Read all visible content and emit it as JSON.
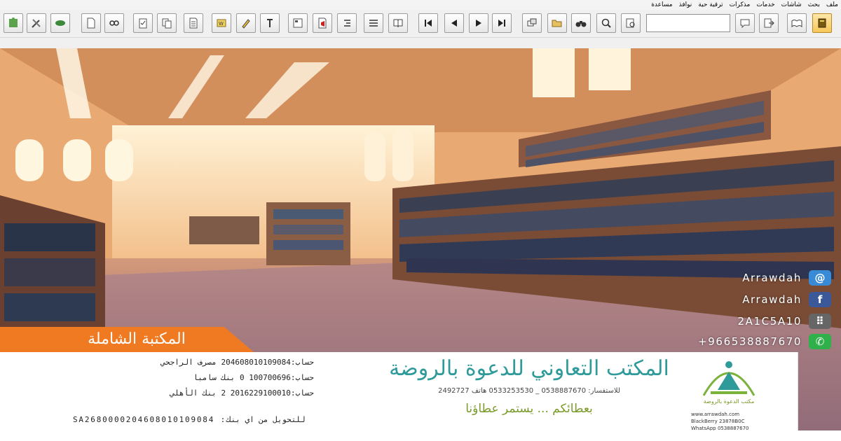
{
  "menu": [
    "ملف",
    "بحث",
    "شاشات",
    "خدمات",
    "مذكرات",
    "ترقية حية",
    "نوافذ",
    "مساعدة"
  ],
  "toolbar": {
    "buttons": [
      {
        "icon": "puzzle-icon"
      },
      {
        "icon": "tools-icon"
      },
      {
        "icon": "leaf-icon"
      },
      {
        "icon": "new-document-icon"
      },
      {
        "icon": "link-icon"
      },
      {
        "icon": "clipboard-icon"
      },
      {
        "icon": "copy-icon"
      },
      {
        "icon": "document-list-icon"
      },
      {
        "icon": "word-icon"
      },
      {
        "icon": "pencil-icon"
      },
      {
        "icon": "text-format-icon"
      },
      {
        "icon": "form-icon"
      },
      {
        "icon": "pdf-icon"
      },
      {
        "icon": "indent-icon"
      },
      {
        "icon": "justify-icon"
      },
      {
        "icon": "book-icon"
      },
      {
        "icon": "first-page-icon"
      },
      {
        "icon": "previous-page-icon"
      },
      {
        "icon": "next-page-icon"
      },
      {
        "icon": "last-page-icon"
      },
      {
        "icon": "windows-icon"
      },
      {
        "icon": "open-folder-icon"
      },
      {
        "icon": "binoculars-icon"
      },
      {
        "icon": "zoom-search-icon"
      },
      {
        "icon": "search-document-icon"
      },
      {
        "icon": "comment-icon"
      },
      {
        "icon": "export-icon"
      },
      {
        "icon": "open-book-icon"
      },
      {
        "icon": "library-book-icon"
      }
    ],
    "search_value": ""
  },
  "contacts": [
    {
      "icon": "email-icon",
      "text": "Arrawdah",
      "color": "#3a8bd6"
    },
    {
      "icon": "facebook-icon",
      "text": "Arrawdah",
      "color": "#3b5998"
    },
    {
      "icon": "bbm-icon",
      "text": "2A1C5A10",
      "color": "#666666"
    },
    {
      "icon": "whatsapp-icon",
      "text": "+966538887670",
      "color": "#2fb04a"
    }
  ],
  "banner": {
    "title": "المكتبة الشاملة",
    "color": "#f07a22"
  },
  "accounts": [
    "حساب:204608010109084 مصرف الراجحي",
    "حساب:100700696 0 بنك سامبا",
    "حساب:2016229100010 2 بنك الأهلي"
  ],
  "iban": "SA2680000204608010109084 :للتحويل من اي بنك",
  "office": {
    "name": "المكتب التعاوني للدعوة بالروضة",
    "phones": "للاستفسار: 0538887670 _ 0533253530 هاتف 2492727",
    "slogan": "بعطائكم ... يستمر عطاؤنا",
    "accent": "#2f9a9a"
  },
  "logo": {
    "caption": "مكتب الدعوة بالروضة",
    "url": "www.arrawdah.com",
    "line1": "BlackBerry 23878B0C",
    "line2": "WhatsApp 0538887670"
  }
}
